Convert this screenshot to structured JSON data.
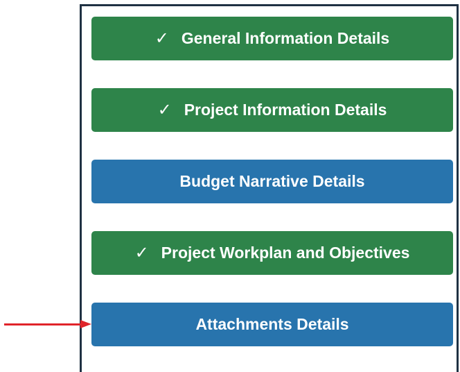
{
  "sections": [
    {
      "label": "General Information Details",
      "status": "complete",
      "check_icon": "✓"
    },
    {
      "label": "Project Information Details",
      "status": "complete",
      "check_icon": "✓"
    },
    {
      "label": "Budget Narrative Details",
      "status": "incomplete"
    },
    {
      "label": "Project Workplan and Objectives",
      "status": "complete",
      "check_icon": "✓"
    },
    {
      "label": "Attachments Details",
      "status": "incomplete"
    }
  ],
  "colors": {
    "complete": "#2e844a",
    "incomplete": "#2874ad",
    "panel_border": "#1f3143",
    "annotation_arrow": "#e0242a"
  },
  "annotation": {
    "icon": "red-arrow-icon",
    "points_to": "Attachments Details"
  }
}
